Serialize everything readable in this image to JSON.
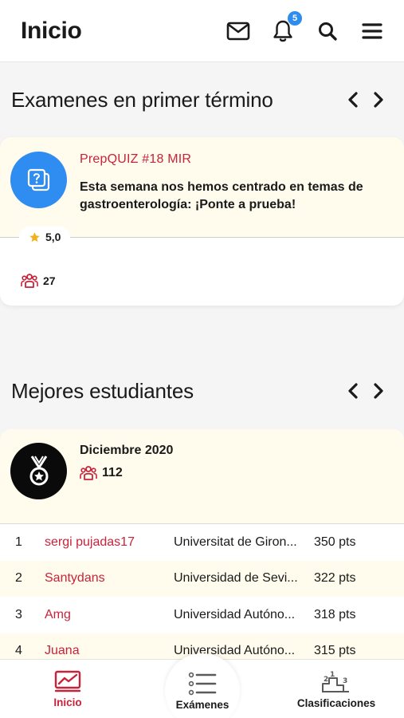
{
  "header": {
    "title": "Inicio",
    "notifications_count": "5",
    "icons": [
      "mail-icon",
      "bell-icon",
      "search-icon",
      "menu-icon"
    ]
  },
  "featured": {
    "title": "Examenes en primer término",
    "exam": {
      "name": "PrepQUIZ #18 MIR",
      "description": "Esta semana nos hemos centrado en temas de gastroenterología: ¡Ponte a prueba!",
      "rating": "5,0",
      "participants": "27"
    }
  },
  "students": {
    "title": "Mejores estudiantes",
    "month": "Diciembre 2020",
    "participants": "112",
    "ranking": [
      {
        "pos": "1",
        "user": "sergi pujadas17",
        "uni": "Universitat de Giron...",
        "pts": "350 pts"
      },
      {
        "pos": "2",
        "user": "Santydans",
        "uni": "Universidad de Sevi...",
        "pts": "322 pts"
      },
      {
        "pos": "3",
        "user": "Amg",
        "uni": "Universidad Autóno...",
        "pts": "318 pts"
      },
      {
        "pos": "4",
        "user": "Juana",
        "uni": "Universidad Autóno...",
        "pts": "315 pts"
      }
    ]
  },
  "bottom_nav": {
    "home": "Inicio",
    "exams": "Exámenes",
    "rankings": "Clasificaciones"
  },
  "colors": {
    "accent": "#c8233a",
    "badge": "#2d8cf0",
    "card_highlight": "#fffbed",
    "star": "#f2b01e"
  }
}
